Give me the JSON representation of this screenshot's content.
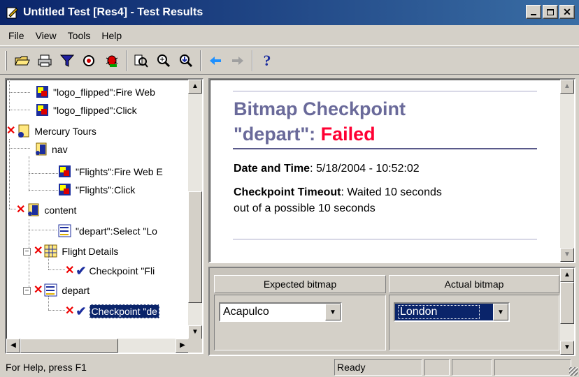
{
  "window": {
    "title": "Untitled Test [Res4] - Test Results"
  },
  "menu": [
    "File",
    "View",
    "Tools",
    "Help"
  ],
  "toolbar": {
    "buttons": [
      "open-icon",
      "print-icon",
      "filter-icon",
      "find-icon",
      "bug-icon",
      "zoom-results-icon",
      "zoom-in-icon",
      "zoom-out-icon",
      "back-arrow-icon",
      "forward-arrow-icon",
      "help-icon"
    ],
    "help_glyph": "?"
  },
  "tree": {
    "nodes": [
      {
        "label": "\"logo_flipped\":Fire Web"
      },
      {
        "label": "\"logo_flipped\":Click"
      },
      {
        "label": "Mercury Tours"
      },
      {
        "label": "nav"
      },
      {
        "label": "\"Flights\":Fire Web E"
      },
      {
        "label": "\"Flights\":Click"
      },
      {
        "label": "content"
      },
      {
        "label": "\"depart\":Select \"Lo"
      },
      {
        "label": "Flight Details"
      },
      {
        "label": "Checkpoint \"Fli"
      },
      {
        "label": "depart"
      },
      {
        "label": "Checkpoint \"de"
      }
    ],
    "expanders": [
      "−",
      "−"
    ]
  },
  "result": {
    "title_line1": "Bitmap Checkpoint",
    "title_line2": "\"depart\": ",
    "status": "Failed",
    "date_label": "Date and Time",
    "date_value": ": 5/18/2004 - 10:52:02",
    "timeout_label": "Checkpoint Timeout",
    "timeout_value": ": Waited 10 seconds",
    "timeout_value2": "out of a possible 10 seconds"
  },
  "bitmaps": {
    "expected_header": "Expected bitmap",
    "actual_header": "Actual bitmap",
    "expected_value": "Acapulco",
    "actual_value": "London"
  },
  "status": {
    "help": "For Help, press F1",
    "state": "Ready"
  },
  "colors": {
    "failed": "#ff0033",
    "title_text": "#6a6a9a",
    "selection": "#0a246a",
    "titlebar": "#0a246a"
  }
}
